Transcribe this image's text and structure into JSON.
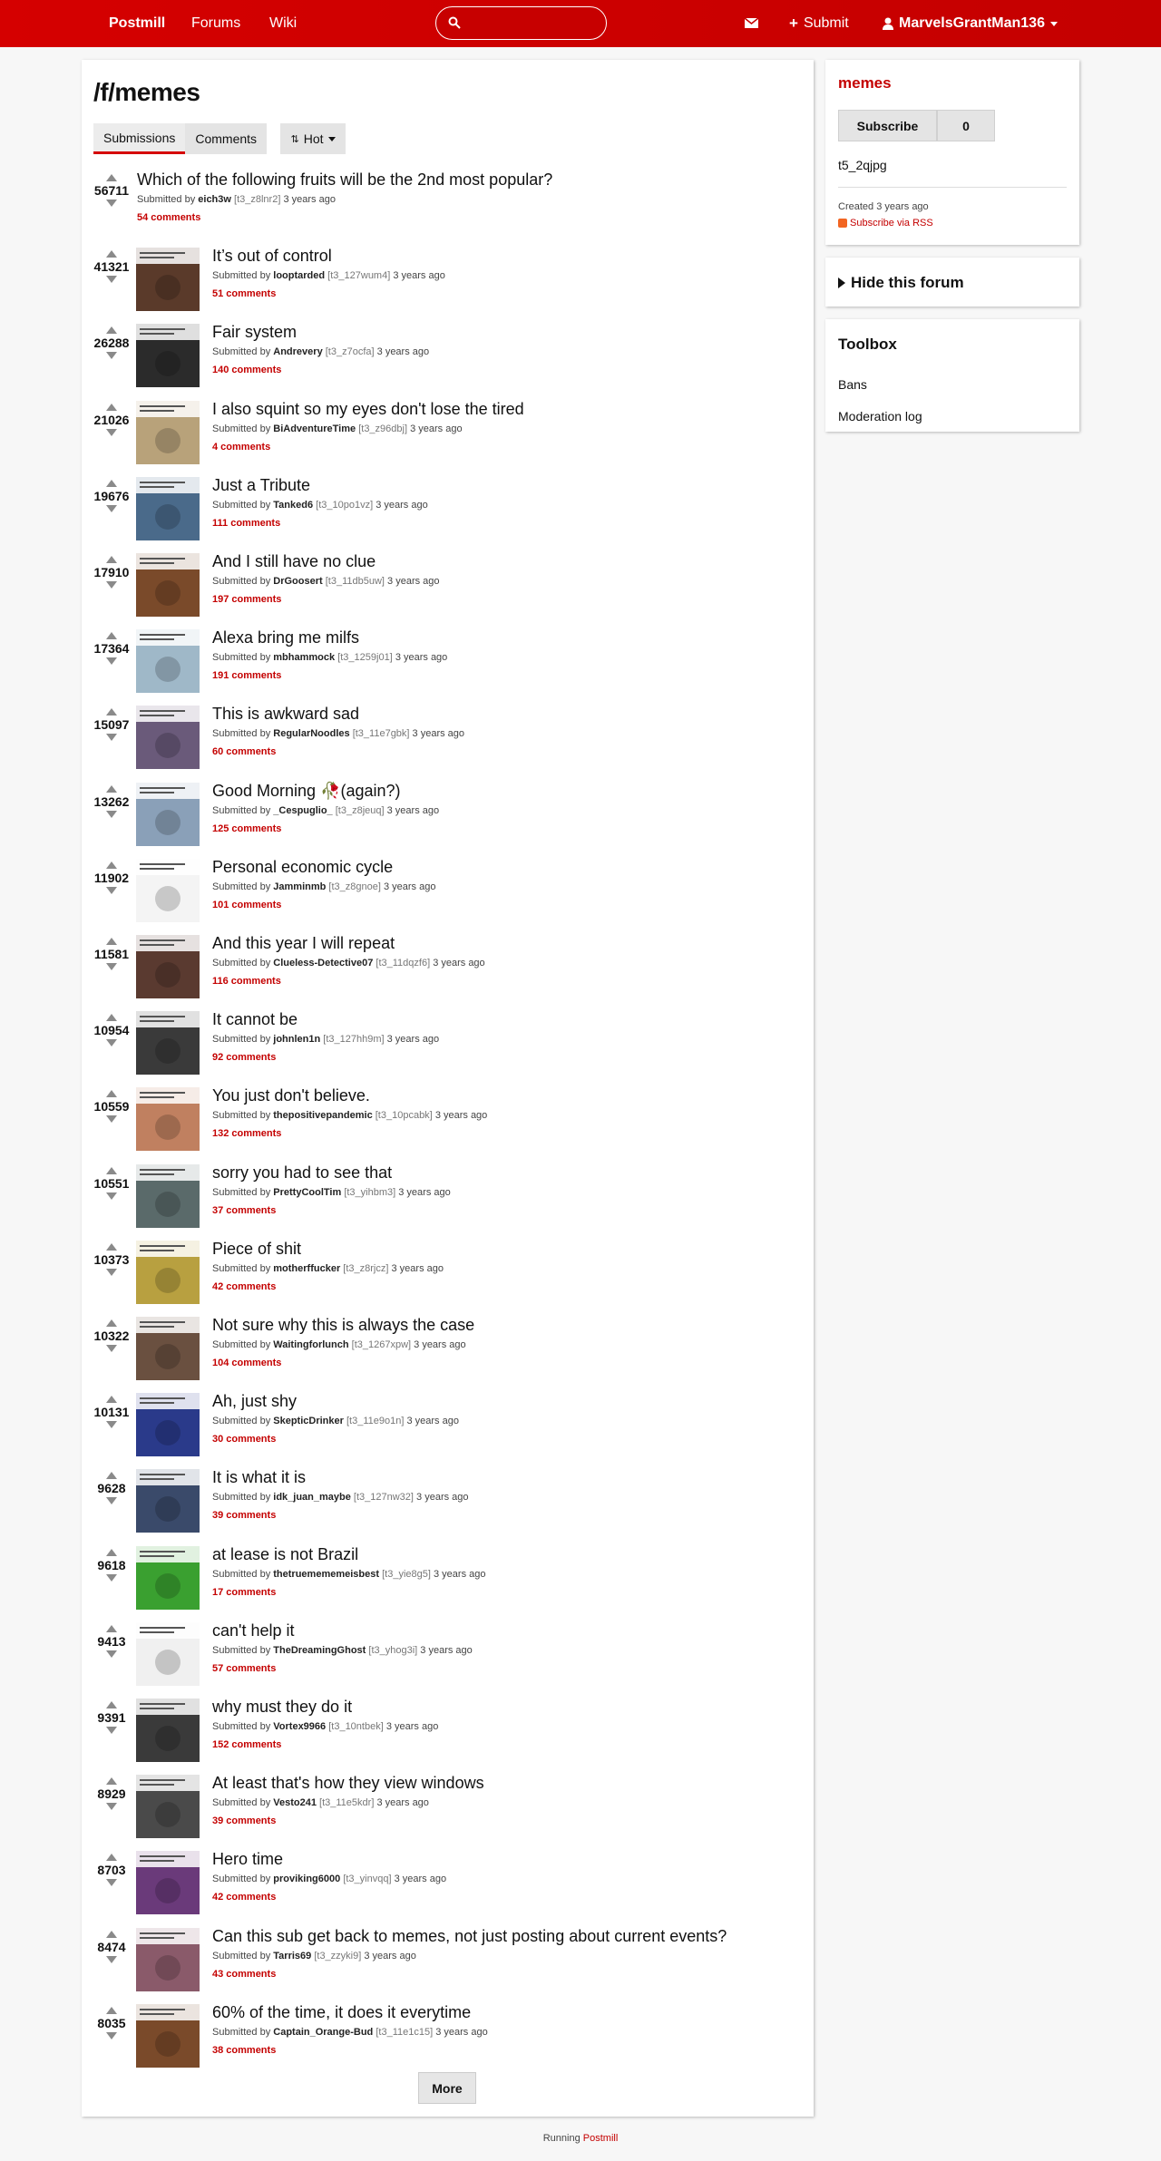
{
  "header": {
    "brand": "Postmill",
    "nav": [
      "Forums",
      "Wiki"
    ],
    "submit_label": "Submit",
    "username": "MarvelsGrantMan136"
  },
  "page": {
    "title": "/f/memes",
    "tabs": [
      "Submissions",
      "Comments"
    ],
    "sort_label": "Hot",
    "more_label": "More"
  },
  "posts": [
    {
      "score": "56711",
      "title": "Which of the following fruits will be the 2nd most popular?",
      "user": "eich3w",
      "id": "[t3_z8lnr2]",
      "time": "3 years ago",
      "comments": "54 comments",
      "thumb": null
    },
    {
      "score": "41321",
      "title": "It’s out of control",
      "user": "looptarded",
      "id": "[t3_127wum4]",
      "time": "3 years ago",
      "comments": "51 comments",
      "thumb": "#5a3a2a"
    },
    {
      "score": "26288",
      "title": "Fair system",
      "user": "Andrevery",
      "id": "[t3_z7ocfa]",
      "time": "3 years ago",
      "comments": "140 comments",
      "thumb": "#2b2b2b"
    },
    {
      "score": "21026",
      "title": "I also squint so my eyes don't lose the tired",
      "user": "BiAdventureTime",
      "id": "[t3_z96dbj]",
      "time": "3 years ago",
      "comments": "4 comments",
      "thumb": "#b8a27a"
    },
    {
      "score": "19676",
      "title": "Just a Tribute",
      "user": "Tanked6",
      "id": "[t3_10po1vz]",
      "time": "3 years ago",
      "comments": "111 comments",
      "thumb": "#4a6a8a"
    },
    {
      "score": "17910",
      "title": "And I still have no clue",
      "user": "DrGoosert",
      "id": "[t3_11db5uw]",
      "time": "3 years ago",
      "comments": "197 comments",
      "thumb": "#7a4a2a"
    },
    {
      "score": "17364",
      "title": "Alexa bring me milfs",
      "user": "mbhammock",
      "id": "[t3_1259j01]",
      "time": "3 years ago",
      "comments": "191 comments",
      "thumb": "#9fb8c8"
    },
    {
      "score": "15097",
      "title": "This is awkward sad",
      "user": "RegularNoodles",
      "id": "[t3_11e7gbk]",
      "time": "3 years ago",
      "comments": "60 comments",
      "thumb": "#6a5a7a"
    },
    {
      "score": "13262",
      "title": "Good Morning 🥀(again?)",
      "user": "_Cespuglio_",
      "id": "[t3_z8jeuq]",
      "time": "3 years ago",
      "comments": "125 comments",
      "thumb": "#8aa0b8"
    },
    {
      "score": "11902",
      "title": "Personal economic cycle",
      "user": "Jamminmb",
      "id": "[t3_z8gnoe]",
      "time": "3 years ago",
      "comments": "101 comments",
      "thumb": "#f4f4f4"
    },
    {
      "score": "11581",
      "title": "And this year I will repeat",
      "user": "Clueless-Detective07",
      "id": "[t3_11dqzf6]",
      "time": "3 years ago",
      "comments": "116 comments",
      "thumb": "#5a3a30"
    },
    {
      "score": "10954",
      "title": "It cannot be",
      "user": "johnlen1n",
      "id": "[t3_127hh9m]",
      "time": "3 years ago",
      "comments": "92 comments",
      "thumb": "#3a3a3a"
    },
    {
      "score": "10559",
      "title": "You just don't believe.",
      "user": "thepositivepandemic",
      "id": "[t3_10pcabk]",
      "time": "3 years ago",
      "comments": "132 comments",
      "thumb": "#c08060"
    },
    {
      "score": "10551",
      "title": "sorry you had to see that",
      "user": "PrettyCoolTim",
      "id": "[t3_yihbm3]",
      "time": "3 years ago",
      "comments": "37 comments",
      "thumb": "#5a6a6a"
    },
    {
      "score": "10373",
      "title": "Piece of shit",
      "user": "motherffucker",
      "id": "[t3_z8rjcz]",
      "time": "3 years ago",
      "comments": "42 comments",
      "thumb": "#b8a040"
    },
    {
      "score": "10322",
      "title": "Not sure why this is always the case",
      "user": "Waitingforlunch",
      "id": "[t3_1267xpw]",
      "time": "3 years ago",
      "comments": "104 comments",
      "thumb": "#6a5040"
    },
    {
      "score": "10131",
      "title": "Ah, just shy",
      "user": "SkepticDrinker",
      "id": "[t3_11e9o1n]",
      "time": "3 years ago",
      "comments": "30 comments",
      "thumb": "#2a3a8a"
    },
    {
      "score": "9628",
      "title": "It is what it is",
      "user": "idk_juan_maybe",
      "id": "[t3_127nw32]",
      "time": "3 years ago",
      "comments": "39 comments",
      "thumb": "#3a4a6a"
    },
    {
      "score": "9618",
      "title": "at lease is not Brazil",
      "user": "thetruemememeisbest",
      "id": "[t3_yie8g5]",
      "time": "3 years ago",
      "comments": "17 comments",
      "thumb": "#3aa030"
    },
    {
      "score": "9413",
      "title": "can't help it",
      "user": "TheDreamingGhost",
      "id": "[t3_yhog3i]",
      "time": "3 years ago",
      "comments": "57 comments",
      "thumb": "#f0f0f0"
    },
    {
      "score": "9391",
      "title": "why must they do it",
      "user": "Vortex9966",
      "id": "[t3_10ntbek]",
      "time": "3 years ago",
      "comments": "152 comments",
      "thumb": "#3a3a3a"
    },
    {
      "score": "8929",
      "title": "At least that's how they view windows",
      "user": "Vesto241",
      "id": "[t3_11e5kdr]",
      "time": "3 years ago",
      "comments": "39 comments",
      "thumb": "#4a4a4a"
    },
    {
      "score": "8703",
      "title": "Hero time",
      "user": "proviking6000",
      "id": "[t3_yinvqq]",
      "time": "3 years ago",
      "comments": "42 comments",
      "thumb": "#6a3a7a"
    },
    {
      "score": "8474",
      "title": "Can this sub get back to memes, not just posting about current events?",
      "user": "Tarris69",
      "id": "[t3_zzyki9]",
      "time": "3 years ago",
      "comments": "43 comments",
      "thumb": "#8a5a6a"
    },
    {
      "score": "8035",
      "title": "60% of the time, it does it everytime",
      "user": "Captain_Orange-Bud",
      "id": "[t3_11e1c15]",
      "time": "3 years ago",
      "comments": "38 comments",
      "thumb": "#7a4a2a"
    }
  ],
  "sidebar": {
    "forum_name": "memes",
    "subscribe_label": "Subscribe",
    "subscriber_count": "0",
    "forum_id": "t5_2qjpg",
    "created": "Created 3 years ago",
    "rss_label": "Subscribe via RSS",
    "hide_label": "Hide this forum",
    "toolbox_title": "Toolbox",
    "toolbox_links": [
      "Bans",
      "Moderation log"
    ]
  },
  "footer": {
    "prefix": "Running",
    "link": "Postmill"
  },
  "colors": {
    "accent": "#d50000",
    "link": "#c40000"
  }
}
